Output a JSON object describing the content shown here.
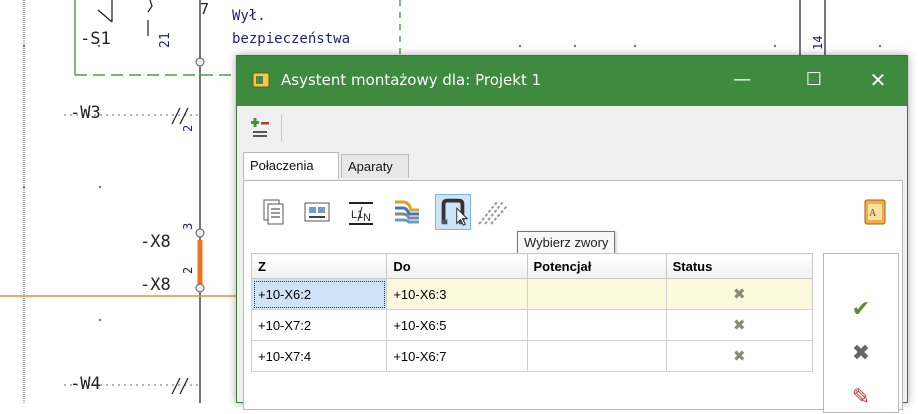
{
  "schematic": {
    "labels": {
      "s1": "-S1",
      "s1_note": "7",
      "s1_pin": "21",
      "w3": "-W3",
      "w3_pin": "2",
      "x8a": "-X8",
      "x8a_pin": "3",
      "x8b": "-X8",
      "x8b_pin": "2",
      "w4": "-W4",
      "wire_14": "14"
    },
    "annotation_line1": "Wył.",
    "annotation_line2": "bezpieczeństwa"
  },
  "dialog": {
    "title": "Asystent montażowy dla: Projekt 1",
    "controls": {
      "minimize": "—",
      "maximize": "☐",
      "close": "✕"
    },
    "tabs": [
      {
        "label": "Połaczenia",
        "active": true
      },
      {
        "label": "Aparaty",
        "active": false
      }
    ],
    "toolbar_icons": [
      "document-list-icon",
      "terminal-card-icon",
      "potential-l1n-icon",
      "cable-bundle-icon",
      "jumper-icon",
      "diagonal-lines-icon",
      "edit-help-icon"
    ],
    "tooltip": "Wybierz zwory",
    "table": {
      "columns": [
        "Z",
        "Do",
        "Potencjał",
        "Status"
      ],
      "rows": [
        {
          "z": "+10-X6:2",
          "do": "+10-X6:3",
          "potencjal": "",
          "status": "✖"
        },
        {
          "z": "+10-X7:2",
          "do": "+10-X6:5",
          "potencjal": "",
          "status": "✖"
        },
        {
          "z": "+10-X7:4",
          "do": "+10-X6:7",
          "potencjal": "",
          "status": "✖"
        }
      ]
    },
    "side_buttons": [
      {
        "icon": "checkmark-icon",
        "glyph": "✔",
        "color": "#5b8a2e"
      },
      {
        "icon": "cross-icon",
        "glyph": "✖",
        "color": "#666666"
      },
      {
        "icon": "clear-status-icon",
        "glyph": "✎",
        "color": "#b03a2e"
      }
    ],
    "colors": {
      "titlebar": "#3e8a3e",
      "selected_row": "#fbf8dd",
      "selected_cell": "#cfe3f7"
    }
  }
}
